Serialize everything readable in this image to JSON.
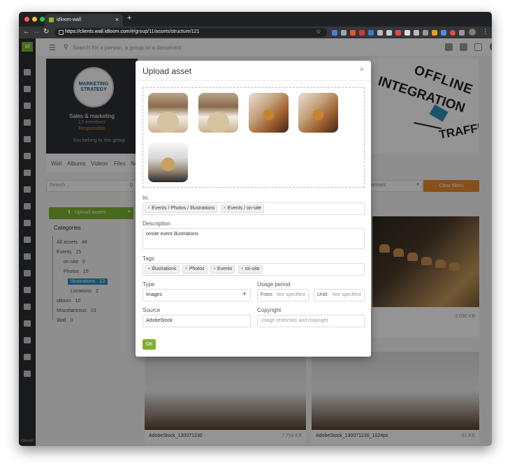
{
  "browser": {
    "tab_title": "idloom-wall",
    "tab_close": "×",
    "new_tab": "+",
    "url_host": "https://clients.wall.idloom.com",
    "url_path": "/#/group/11/assets/structure/121",
    "star": "☆",
    "menu": "⋮"
  },
  "app": {
    "logo": "id",
    "footer_logo": "idloom",
    "search_placeholder": "Search for a person, a group or a document"
  },
  "group": {
    "logo_text": "MARKETING STRATEGY",
    "name": "Sales & marketing",
    "members": "13 members",
    "role": "Responsible",
    "belong": "You belong to this group",
    "tabs": [
      "Wall",
      "Albums",
      "Videos",
      "Files",
      "No"
    ]
  },
  "banner": {
    "line1": "OFFLINE",
    "line2": "INTEGRATION",
    "line3": "TRAFFIC"
  },
  "filters": {
    "search_placeholder": "Search...",
    "formats_placeholder": "ormats",
    "clear_label": "Clear filters"
  },
  "upload_button": "Upload assets",
  "categories": {
    "title": "Categories",
    "items": [
      {
        "label": "All assets",
        "count": "48"
      },
      {
        "label": "Events",
        "count": "15"
      },
      {
        "label": "on-site",
        "count": "0"
      },
      {
        "label": "Photos",
        "count": "15"
      },
      {
        "label": "Illustrations",
        "count": "13"
      },
      {
        "label": "Locations",
        "count": "2"
      },
      {
        "label": "idloom",
        "count": "10"
      },
      {
        "label": "Miscelaneous",
        "count": "23"
      },
      {
        "label": "Wall",
        "count": "0"
      }
    ]
  },
  "grid": {
    "right_size": "3,030 KB",
    "cards": [
      {
        "caption": "AdobeStock_130071230",
        "size": "7,754 KB"
      },
      {
        "caption": "AdobeStock_130071230_1024px",
        "size": "61 KB"
      }
    ]
  },
  "modal": {
    "title": "Upload asset",
    "close": "×",
    "in_label": "In:",
    "in_chips": [
      "Events / Photos / Illustrations",
      "Events / on-site"
    ],
    "description_label": "Description",
    "description_value": "onsite event illustrations",
    "tags_label": "Tags",
    "tags": [
      "Illustrations",
      "Photos",
      "Events",
      "on-site"
    ],
    "type_label": "Type",
    "type_value": "Images",
    "usage_label": "Usage period",
    "from_label": "From:",
    "from_placeholder": "Not specified",
    "until_label": "Until:",
    "until_placeholder": "Not specified",
    "source_label": "Source",
    "source_value": "AdobeStock",
    "copyright_label": "Copyright",
    "copyright_placeholder": "Usage restriction and copyright",
    "ok_label": "OK",
    "chip_remove": "×"
  },
  "colors": {
    "brand_green": "#7cb32e",
    "accent_orange": "#e98a2c",
    "selected_blue": "#2b8fbd"
  }
}
